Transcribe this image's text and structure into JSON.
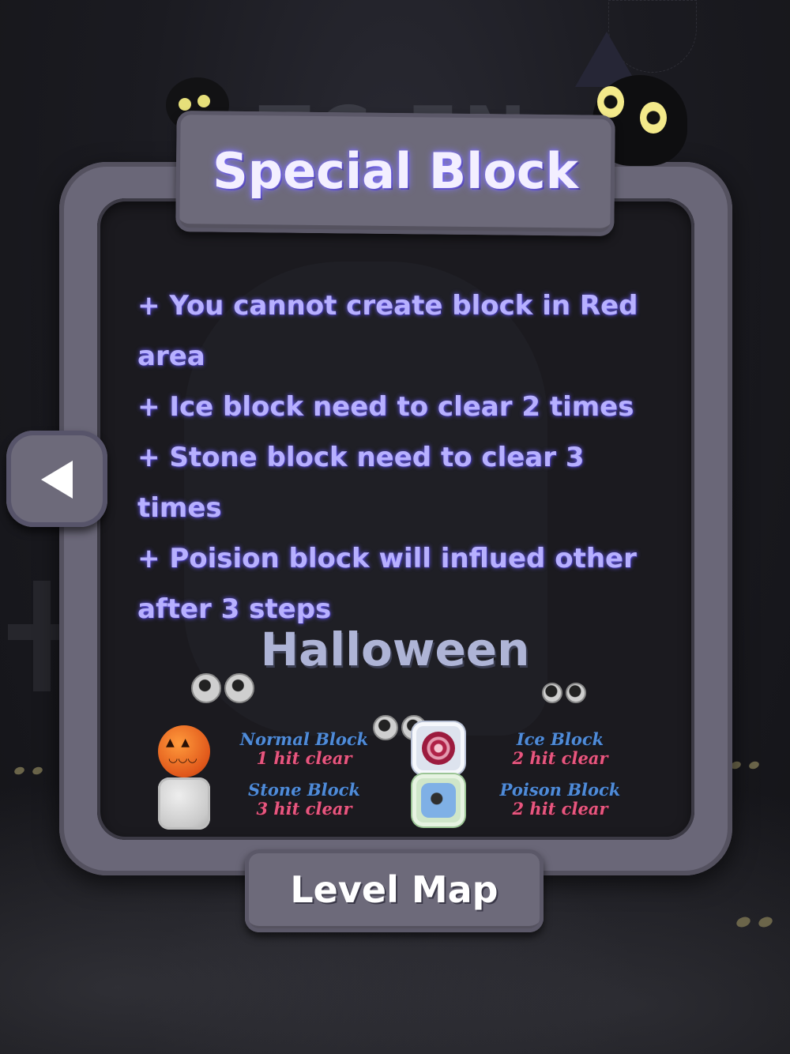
{
  "background": {
    "title_partial": "TC     EN"
  },
  "popup": {
    "title": "Special Block",
    "rules": [
      "+ You cannot create block in Red area",
      "+ Ice block need to clear 2 times",
      "+ Stone block need to clear 3 times",
      "+ Poision block will influed other after 3 steps"
    ],
    "theme_name": "Halloween",
    "blocks": [
      {
        "name": "Normal Block",
        "hit": "1 hit clear",
        "icon": "pumpkin-icon"
      },
      {
        "name": "Ice Block",
        "hit": "2 hit clear",
        "icon": "ice-block-icon"
      },
      {
        "name": "Stone Block",
        "hit": "3 hit clear",
        "icon": "stone-block-icon"
      },
      {
        "name": "Poison Block",
        "hit": "2 hit clear",
        "icon": "poison-block-icon"
      }
    ],
    "level_map_label": "Level Map"
  },
  "colors": {
    "rule_text": "#b7b0ff",
    "block_name": "#4f8bd8",
    "block_hit": "#e8567f",
    "panel": "#6d6a7a"
  }
}
